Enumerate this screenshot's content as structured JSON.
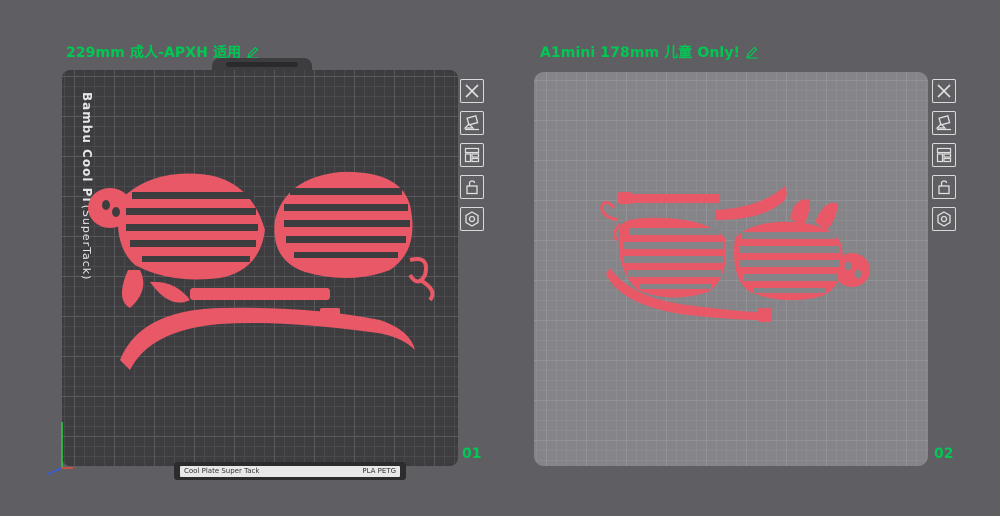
{
  "plates": [
    {
      "title": "229mm 成人-APXH 适用",
      "number": "01",
      "brand_main": "Bambu Cool Pl",
      "brand_sub": "SuperTack",
      "label_left": "Cool Plate Super Tack",
      "label_right": "PLA PETG"
    },
    {
      "title": "A1mini 178mm 儿童 Only!",
      "number": "02"
    }
  ],
  "tool_icons": [
    "close-icon",
    "auto-orient-icon",
    "arrange-icon",
    "lock-icon",
    "settings-icon"
  ],
  "colors": {
    "model": "#e85866",
    "title_green": "#00c853",
    "background": "#5f5f63"
  }
}
